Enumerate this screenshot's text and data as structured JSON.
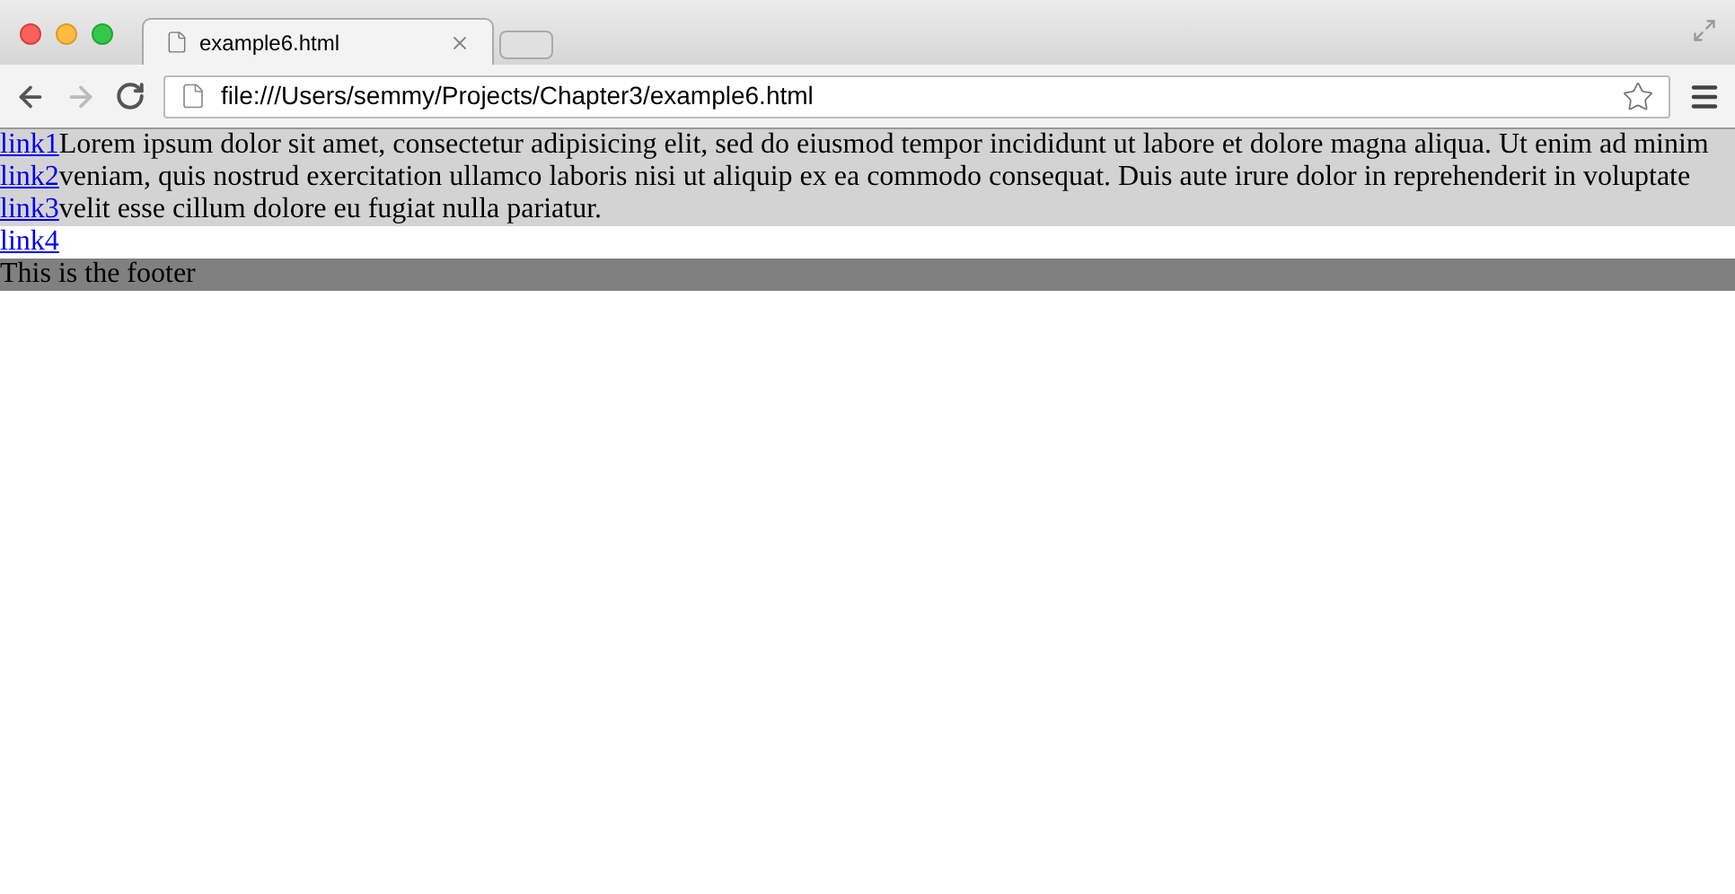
{
  "tabs": [
    {
      "title": "example6.html",
      "selected": true
    }
  ],
  "address_bar": {
    "url": "file:///Users/semmy/Projects/Chapter3/example6.html"
  },
  "page": {
    "nav_links": [
      "link1",
      "link2",
      "link3",
      "link4"
    ],
    "paragraph": "Lorem ipsum dolor sit amet, consectetur adipisicing elit, sed do eiusmod tempor incididunt ut labore et dolore magna aliqua. Ut enim ad minim veniam, quis nostrud exercitation ullamco laboris nisi ut aliquip ex ea commodo consequat. Duis aute irure dolor in reprehenderit in voluptate velit esse cillum dolore eu fugiat nulla pariatur.",
    "footer": "This is the footer"
  }
}
